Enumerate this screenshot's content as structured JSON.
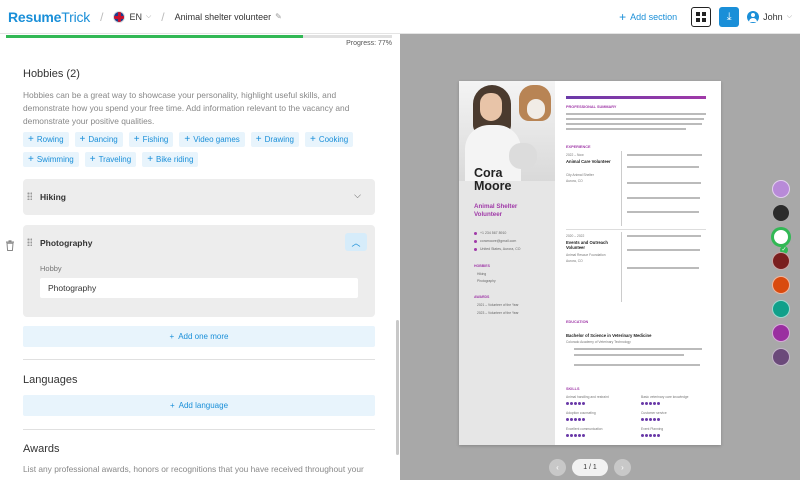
{
  "header": {
    "logo_resume": "Resume",
    "logo_trick": "Trick",
    "language": "EN",
    "document_title": "Animal shelter volunteer",
    "add_section": "Add section",
    "user_name": "John"
  },
  "progress": {
    "label": "Progress: 77%",
    "value": 0.77
  },
  "hobbies": {
    "title": "Hobbies (2)",
    "description": "Hobbies can be a great way to showcase your personality, highlight useful skills, and demonstrate how you spend your free time. Add information relevant to the vacancy and demonstrate your positive qualities.",
    "suggestions": [
      "Rowing",
      "Dancing",
      "Fishing",
      "Video games",
      "Drawing",
      "Cooking",
      "Swimming",
      "Traveling",
      "Bike riding"
    ],
    "items": [
      {
        "title": "Hiking"
      },
      {
        "title": "Photography",
        "field_label": "Hobby",
        "field_value": "Photography"
      }
    ],
    "add_more": "Add one more"
  },
  "languages": {
    "title": "Languages",
    "add_label": "Add language"
  },
  "awards": {
    "title": "Awards",
    "description": "List any professional awards, honors or recognitions that you have received throughout your"
  },
  "resume": {
    "first_name": "Cora",
    "last_name": "Moore",
    "job_title": "Animal Shelter Volunteer",
    "phone": "+1 234 567 8910",
    "email": "coramoore@gmail.com",
    "location": "United States, Aurora, CO",
    "hobbies_heading": "HOBBIES",
    "hobby_1": "Hiking",
    "hobby_2": "Photography",
    "awards_heading": "AWARDS",
    "award_1": "2021 – Volunteer of the Year",
    "award_2": "2023 – Volunteer of the Year",
    "summary_heading": "PROFESSIONAL SUMMARY",
    "experience_heading": "EXPERIENCE",
    "job1_dates": "2022 – Now",
    "job1_title": "Animal Care Volunteer",
    "job1_org": "City Animal Shelter",
    "job1_place": "Aurora, CO",
    "job2_dates": "2020 – 2022",
    "job2_title": "Events and Outreach Volunteer",
    "job2_org": "Animal Rescue Foundation",
    "job2_place": "Aurora, CO",
    "education_heading": "EDUCATION",
    "degree": "Bachelor of Science in Veterinary Medicine",
    "school": "Colorado Academy of Veterinary Technology",
    "skills_heading": "SKILLS",
    "skill_1": "Animal handling and restraint",
    "skill_2": "Basic veterinary care knowledge",
    "skill_3": "Adoption counseling",
    "skill_4": "Customer service",
    "skill_5": "Excellent communication",
    "skill_6": "Event Planning"
  },
  "palette": [
    "#b88ad8",
    "#2b2b2b",
    "#ffffff",
    "#7a1e1e",
    "#d94a0e",
    "#0fa08a",
    "#9a2fa0",
    "#6b4a7a"
  ],
  "pager": {
    "label": "1 / 1"
  }
}
